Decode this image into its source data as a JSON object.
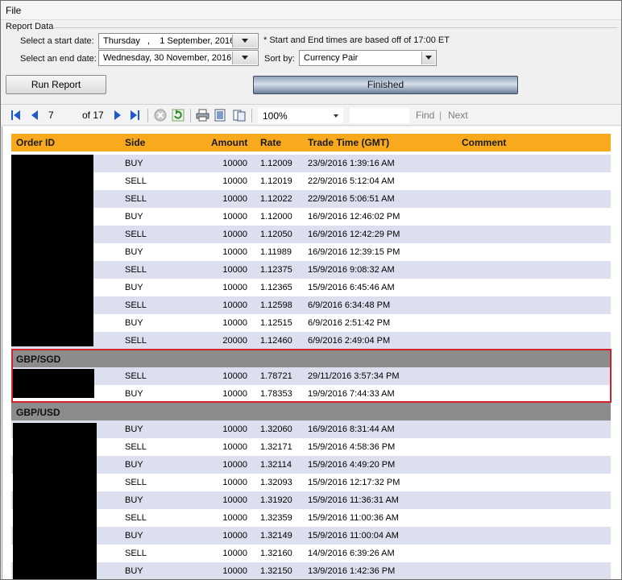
{
  "menu": {
    "file": "File"
  },
  "report_data": {
    "group_label": "Report Data",
    "start_label": "Select a start date:",
    "start_value": "Thursday   ,    1 September, 2016",
    "end_label": "Select an end date:",
    "end_value": "Wednesday, 30 November, 2016",
    "note": "* Start and End times are based off of 17:00 ET",
    "sort_label": "Sort by:",
    "sort_value": "Currency Pair",
    "run_button": "Run Report",
    "status": "Finished"
  },
  "toolbar": {
    "page": "7",
    "of_label": "of",
    "total_pages": "17",
    "zoom": "100%",
    "find": "Find",
    "find_sep": "|",
    "next": "Next"
  },
  "table": {
    "headers": [
      "Order ID",
      "Side",
      "Amount",
      "Rate",
      "Trade Time (GMT)",
      "Comment"
    ],
    "groups": [
      {
        "name": "",
        "rows": [
          {
            "side": "BUY",
            "amount": "10000",
            "rate": "1.12009",
            "time": "23/9/2016 1:39:16 AM"
          },
          {
            "side": "SELL",
            "amount": "10000",
            "rate": "1.12019",
            "time": "22/9/2016 5:12:04 AM"
          },
          {
            "side": "SELL",
            "amount": "10000",
            "rate": "1.12022",
            "time": "22/9/2016 5:06:51 AM"
          },
          {
            "side": "BUY",
            "amount": "10000",
            "rate": "1.12000",
            "time": "16/9/2016 12:46:02 PM"
          },
          {
            "side": "SELL",
            "amount": "10000",
            "rate": "1.12050",
            "time": "16/9/2016 12:42:29 PM"
          },
          {
            "side": "BUY",
            "amount": "10000",
            "rate": "1.11989",
            "time": "16/9/2016 12:39:15 PM"
          },
          {
            "side": "SELL",
            "amount": "10000",
            "rate": "1.12375",
            "time": "15/9/2016 9:08:32 AM"
          },
          {
            "side": "BUY",
            "amount": "10000",
            "rate": "1.12365",
            "time": "15/9/2016 6:45:46 AM"
          },
          {
            "side": "SELL",
            "amount": "10000",
            "rate": "1.12598",
            "time": "6/9/2016 6:34:48 PM"
          },
          {
            "side": "BUY",
            "amount": "10000",
            "rate": "1.12515",
            "time": "6/9/2016 2:51:42 PM"
          },
          {
            "side": "SELL",
            "amount": "20000",
            "rate": "1.12460",
            "time": "6/9/2016 2:49:04 PM"
          }
        ]
      },
      {
        "name": "GBP/SGD",
        "rows": [
          {
            "side": "SELL",
            "amount": "10000",
            "rate": "1.78721",
            "time": "29/11/2016 3:57:34 PM"
          },
          {
            "side": "BUY",
            "amount": "10000",
            "rate": "1.78353",
            "time": "19/9/2016 7:44:33 AM"
          }
        ]
      },
      {
        "name": "GBP/USD",
        "rows": [
          {
            "side": "BUY",
            "amount": "10000",
            "rate": "1.32060",
            "time": "16/9/2016 8:31:44 AM"
          },
          {
            "side": "SELL",
            "amount": "10000",
            "rate": "1.32171",
            "time": "15/9/2016 4:58:36 PM"
          },
          {
            "side": "BUY",
            "amount": "10000",
            "rate": "1.32114",
            "time": "15/9/2016 4:49:20 PM"
          },
          {
            "side": "SELL",
            "amount": "10000",
            "rate": "1.32093",
            "time": "15/9/2016 12:17:32 PM"
          },
          {
            "side": "BUY",
            "amount": "10000",
            "rate": "1.31920",
            "time": "15/9/2016 11:36:31 AM"
          },
          {
            "side": "SELL",
            "amount": "10000",
            "rate": "1.32359",
            "time": "15/9/2016 11:00:36 AM"
          },
          {
            "side": "BUY",
            "amount": "10000",
            "rate": "1.32149",
            "time": "15/9/2016 11:00:04 AM"
          },
          {
            "side": "SELL",
            "amount": "10000",
            "rate": "1.32160",
            "time": "14/9/2016 6:39:26 AM"
          },
          {
            "side": "BUY",
            "amount": "10000",
            "rate": "1.32150",
            "time": "13/9/2016 1:42:36 PM"
          }
        ]
      }
    ]
  },
  "colors": {
    "header_bg": "#f9a91e",
    "row_alt": "#dce0ee",
    "group_bg": "#8c8c8c",
    "highlight": "#d3222a",
    "nav_blue": "#1e5bc6"
  },
  "icons": [
    "first-page-icon",
    "prev-page-icon",
    "next-page-icon",
    "last-page-icon",
    "stop-icon",
    "refresh-icon",
    "print-icon",
    "print-layout-icon",
    "page-setup-icon"
  ]
}
